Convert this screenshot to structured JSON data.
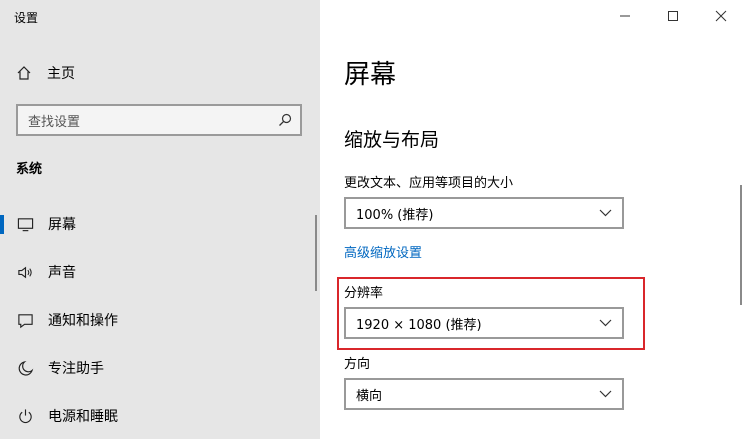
{
  "window": {
    "title": "设置"
  },
  "sidebar": {
    "home_label": "主页",
    "search_placeholder": "查找设置",
    "section": "系统",
    "items": [
      {
        "label": "屏幕",
        "icon": "monitor-icon",
        "active": true
      },
      {
        "label": "声音",
        "icon": "speaker-icon",
        "active": false
      },
      {
        "label": "通知和操作",
        "icon": "notification-icon",
        "active": false
      },
      {
        "label": "专注助手",
        "icon": "moon-icon",
        "active": false
      },
      {
        "label": "电源和睡眠",
        "icon": "power-icon",
        "active": false
      }
    ]
  },
  "main": {
    "title": "屏幕",
    "section_title": "缩放与布局",
    "scale_label": "更改文本、应用等项目的大小",
    "scale_value": "100% (推荐)",
    "advanced_link": "高级缩放设置",
    "resolution_label": "分辨率",
    "resolution_value": "1920 × 1080 (推荐)",
    "orientation_label": "方向",
    "orientation_value": "横向"
  },
  "colors": {
    "accent": "#0067c0",
    "highlight": "#d9262b",
    "sidebar_bg": "#e6e6e6"
  }
}
